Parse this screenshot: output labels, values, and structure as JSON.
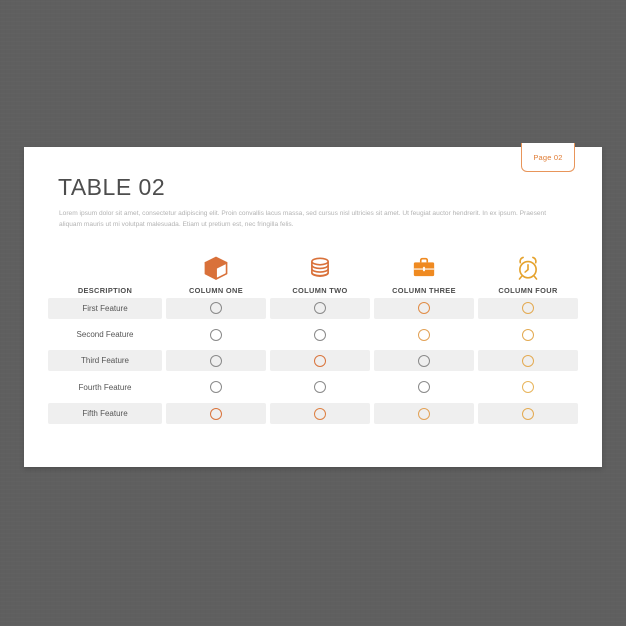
{
  "background": {
    "color": "#5f5f5f"
  },
  "card": {
    "badge_label": "Page 02",
    "title": "TABLE 02",
    "intro": "Lorem ipsum dolor sit amet, consectetur adipiscing elit. Proin convallis lacus massa, sed cursus nisl ultricies sit amet. Ut feugiat auctor hendrerit. In ex ipsum. Praesent aliquam mauris ut mi volutpat malesuada. Etiam ut pretium est, nec fringilla felis."
  },
  "colors": {
    "accent": "#e07b33",
    "accent_light": "#e8a45f",
    "accent_amber": "#e3aa52",
    "neutral_circle": "#8a8a8a",
    "row_shade": "#efefef"
  },
  "table": {
    "description_header": "DESCRIPTION",
    "columns": [
      {
        "label": "COLUMN ONE",
        "icon": "box-icon"
      },
      {
        "label": "COLUMN TWO",
        "icon": "database-icon"
      },
      {
        "label": "COLUMN THREE",
        "icon": "briefcase-icon"
      },
      {
        "label": "COLUMN FOUR",
        "icon": "alarm-clock-icon"
      }
    ],
    "rows": [
      {
        "label": "First Feature",
        "shaded": true,
        "cells": [
          {
            "state": "inactive",
            "color": "#8a8a8a"
          },
          {
            "state": "inactive",
            "color": "#8a8a8a"
          },
          {
            "state": "active",
            "color": "#e08c46"
          },
          {
            "state": "active",
            "color": "#e3aa52"
          }
        ]
      },
      {
        "label": "Second Feature",
        "shaded": false,
        "cells": [
          {
            "state": "inactive",
            "color": "#8a8a8a"
          },
          {
            "state": "inactive",
            "color": "#8a8a8a"
          },
          {
            "state": "active",
            "color": "#e2a257"
          },
          {
            "state": "active",
            "color": "#e3aa52"
          }
        ]
      },
      {
        "label": "Third Feature",
        "shaded": true,
        "cells": [
          {
            "state": "inactive",
            "color": "#8a8a8a"
          },
          {
            "state": "active",
            "color": "#d9743c"
          },
          {
            "state": "inactive",
            "color": "#8a8a8a"
          },
          {
            "state": "active",
            "color": "#e3aa52"
          }
        ]
      },
      {
        "label": "Fourth Feature",
        "shaded": false,
        "cells": [
          {
            "state": "inactive",
            "color": "#8a8a8a"
          },
          {
            "state": "inactive",
            "color": "#8a8a8a"
          },
          {
            "state": "inactive",
            "color": "#8a8a8a"
          },
          {
            "state": "active",
            "color": "#e8b55c"
          }
        ]
      },
      {
        "label": "Fifth Feature",
        "shaded": true,
        "cells": [
          {
            "state": "active",
            "color": "#d9743c"
          },
          {
            "state": "active",
            "color": "#dd8043"
          },
          {
            "state": "active",
            "color": "#e2a257"
          },
          {
            "state": "active",
            "color": "#e3aa52"
          }
        ]
      }
    ]
  }
}
